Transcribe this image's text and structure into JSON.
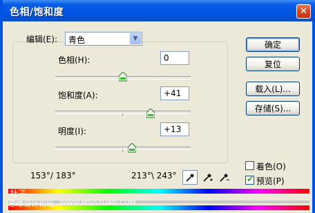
{
  "window": {
    "title": "色相/饱和度",
    "close_glyph": "✕"
  },
  "edit": {
    "label": "编辑(E):",
    "selected": "青色"
  },
  "hue": {
    "label": "色相(H):",
    "value": "0",
    "level_fraction": 0.5
  },
  "saturation": {
    "label": "饱和度(A):",
    "value": "+41",
    "level_fraction": 0.705
  },
  "lightness": {
    "label": "明度(I):",
    "value": "+13",
    "level_fraction": 0.565
  },
  "buttons": {
    "ok": "确定",
    "reset": "复位",
    "load": "载入(L)...",
    "save": "存储(S)..."
  },
  "checkboxes": {
    "colorize_label": "着色(O)",
    "colorize_checked": false,
    "preview_label": "预览(P)",
    "preview_checked": true
  },
  "range": {
    "left": "153°/ 183°",
    "right": "213°\\ 243°"
  },
  "icons": {
    "eyedropper": "eyedropper-icon",
    "eyedropper_plus": "eyedropper-plus-icon",
    "eyedropper_minus": "eyedropper-minus-icon"
  },
  "watermark": {
    "line1": "社子",
    "line2": "思缘设计论坛",
    "line3": "WWW.MISSYUAN.COM"
  },
  "colors": {
    "titlebar": "#0054e3",
    "dialog_bg": "#ece9d8",
    "close_button": "#d8431e",
    "checkmark": "#21a121"
  }
}
